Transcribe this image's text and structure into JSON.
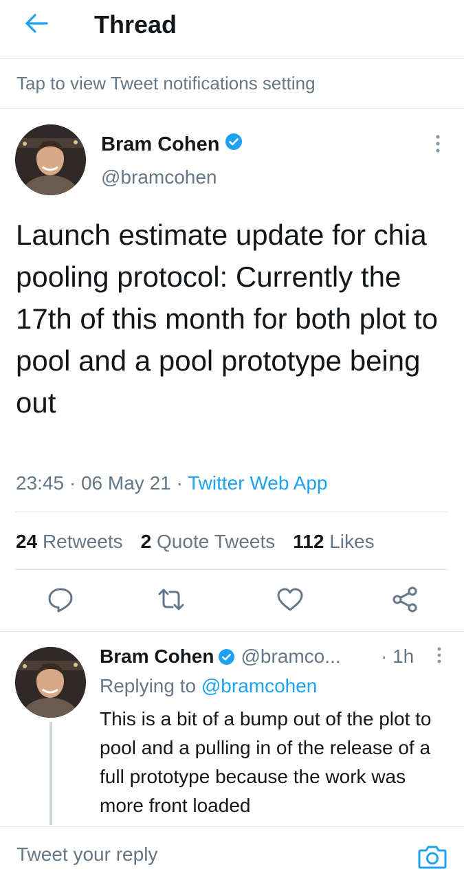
{
  "header": {
    "title": "Thread",
    "back_icon": "arrow-left-icon"
  },
  "notice": {
    "text": "Tap to view Tweet notifications setting"
  },
  "tweet": {
    "author_name": "Bram Cohen",
    "author_handle": "@bramcohen",
    "verified": true,
    "text": "Launch estimate update for chia pooling protocol: Currently the 17th of this month for both plot to pool and a pool prototype being out",
    "time": "23:45",
    "date": "06 May 21",
    "source": "Twitter Web App",
    "separator": "·",
    "stats": {
      "retweets_count": "24",
      "retweets_label": "Retweets",
      "quotes_count": "2",
      "quotes_label": "Quote Tweets",
      "likes_count": "112",
      "likes_label": "Likes"
    },
    "actions": [
      "reply-icon",
      "retweet-icon",
      "like-icon",
      "share-icon"
    ]
  },
  "reply": {
    "author_name": "Bram Cohen",
    "author_handle": "@bramco...",
    "time": "1h",
    "separator": "·",
    "replying_prefix": "Replying to",
    "replying_to": "@bramcohen",
    "text": "This is a bit of a bump out of the plot to pool and a pulling in of the release of a full prototype because the work was more front loaded"
  },
  "composer": {
    "placeholder": "Tweet your reply",
    "camera_icon": "camera-icon"
  },
  "colors": {
    "accent": "#1da1f2",
    "secondary_text": "#657786",
    "primary_text": "#14171a",
    "divider": "#e1e8ed"
  }
}
